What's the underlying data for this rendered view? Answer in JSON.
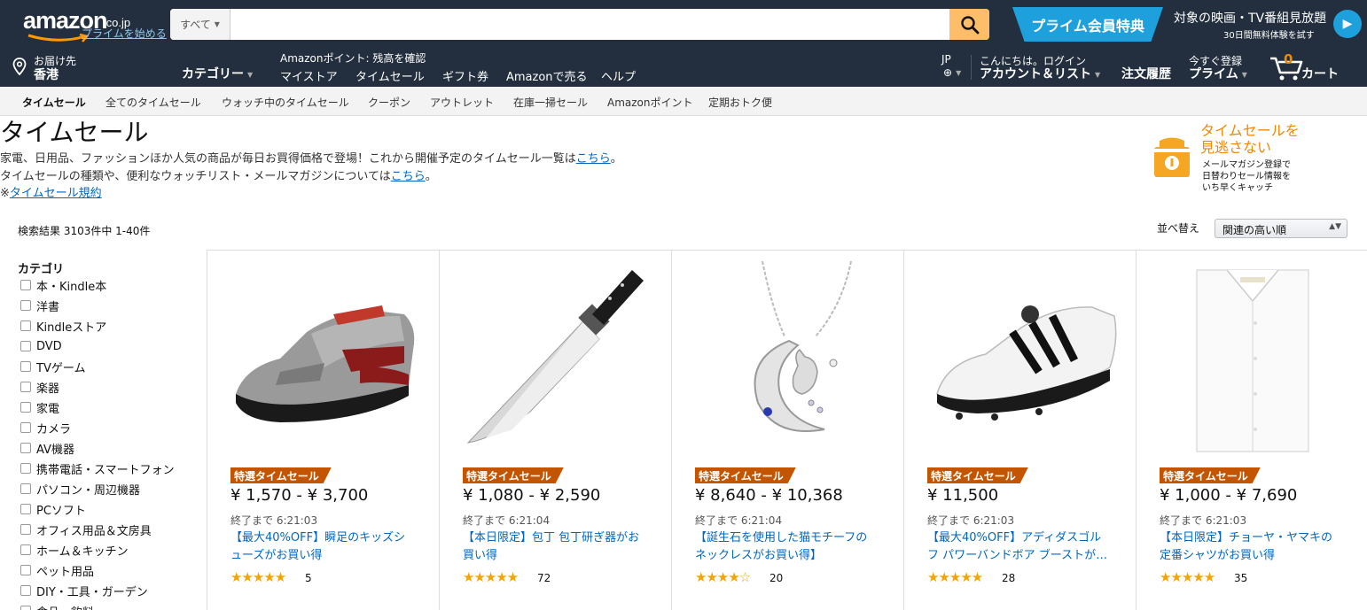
{
  "header": {
    "logo_text": "amazon",
    "logo_tld": ".co.jp",
    "prime_signup": "プライムを始める",
    "search_category": "すべて",
    "search_placeholder": "",
    "prime_banner_label": "プライム会員特典",
    "prime_banner_line1": "対象の映画・TV番組見放題",
    "prime_banner_line2": "30日間無料体験を試す",
    "deliver_line1": "お届け先",
    "deliver_line2": "香港",
    "category_menu": "カテゴリー",
    "points_text": "Amazonポイント: 残高を確認",
    "nav_links": [
      "マイストア",
      "タイムセール",
      "ギフト券",
      "Amazonで売る",
      "ヘルプ"
    ],
    "lang": "JP",
    "account_line1": "こんにちは。ログイン",
    "account_line2": "アカウント＆リスト",
    "orders": "注文履歴",
    "prime_line1": "今すぐ登録",
    "prime_line2": "プライム",
    "cart_count": "0",
    "cart_label": "カート"
  },
  "subnav": [
    "タイムセール",
    "全てのタイムセール",
    "ウォッチ中のタイムセール",
    "クーポン",
    "アウトレット",
    "在庫一掃セール",
    "Amazonポイント",
    "定期おトク便"
  ],
  "page": {
    "title": "タイムセール",
    "desc1": "家電、日用品、ファッションほか人気の商品が毎日お買得価格で登場！これから開催予定のタイムセール一覧は",
    "desc1_link": "こちら",
    "desc1_end": "。",
    "desc2": "タイムセールの種類や、便利なウォッチリスト・メールマガジンについては",
    "desc2_link": "こちら",
    "desc2_end": "。",
    "desc3_prefix": "※",
    "desc3_link": "タイムセール規約",
    "promo_title1": "タイムセールを",
    "promo_title2": "見逃さない",
    "promo_line1": "メールマガジン登録で",
    "promo_line2": "日替わりセール情報を",
    "promo_line3": "いち早くキャッチ",
    "result_count": "検索結果 3103件中 1-40件",
    "sort_label": "並べ替え",
    "sort_value": "関連の高い順"
  },
  "sidebar": {
    "title": "カテゴリ",
    "items": [
      "本・Kindle本",
      "洋書",
      "Kindleストア",
      "DVD",
      "TVゲーム",
      "楽器",
      "家電",
      "カメラ",
      "AV機器",
      "携帯電話・スマートフォン",
      "パソコン・周辺機器",
      "PCソフト",
      "オフィス用品＆文房具",
      "ホーム＆キッチン",
      "ペット用品",
      "DIY・工具・ガーデン",
      "食品・飲料"
    ]
  },
  "products": [
    {
      "badge": "特選タイムセール",
      "price": "¥ 1,570 - ¥ 3,700",
      "timer": "終了まで 6:21:03",
      "title": "【最大40%OFF】瞬足のキッズシューズがお買い得",
      "rating": 4.5,
      "stars": "★★★★★",
      "reviews": "5",
      "image": "kids-sneaker"
    },
    {
      "badge": "特選タイムセール",
      "price": "¥ 1,080 - ¥ 2,590",
      "timer": "終了まで 6:21:04",
      "title": "【本日限定】包丁 包丁研ぎ器がお買い得",
      "rating": 4.5,
      "stars": "★★★★★",
      "reviews": "72",
      "image": "chef-knife"
    },
    {
      "badge": "特選タイムセール",
      "price": "¥ 8,640 - ¥ 10,368",
      "timer": "終了まで 6:21:04",
      "title": "【誕生石を使用した猫モチーフのネックレスがお買い得】",
      "rating": 4.0,
      "stars": "★★★★☆",
      "reviews": "20",
      "image": "cat-moon-necklace"
    },
    {
      "badge": "特選タイムセール",
      "price": "¥ 11,500",
      "timer": "終了まで 6:21:03",
      "title": "【最大40%OFF】アディダスゴルフ パワーバンドボア ブーストが…",
      "rating": 4.5,
      "stars": "★★★★★",
      "reviews": "28",
      "image": "golf-shoe"
    },
    {
      "badge": "特選タイムセール",
      "price": "¥ 1,000 - ¥ 7,690",
      "timer": "終了まで 6:21:03",
      "title": "【本日限定】チョーヤ・ヤマキの定番シャツがお買い得",
      "rating": 4.5,
      "stars": "★★★★★",
      "reviews": "35",
      "image": "dress-shirt"
    }
  ],
  "colors": {
    "nav_bg": "#232f3e",
    "search_button": "#febd69",
    "badge": "#c45500",
    "link": "#0066c0",
    "star": "#f0a500",
    "prime_blue": "#1ea0dc",
    "cart_count": "#f08804"
  }
}
